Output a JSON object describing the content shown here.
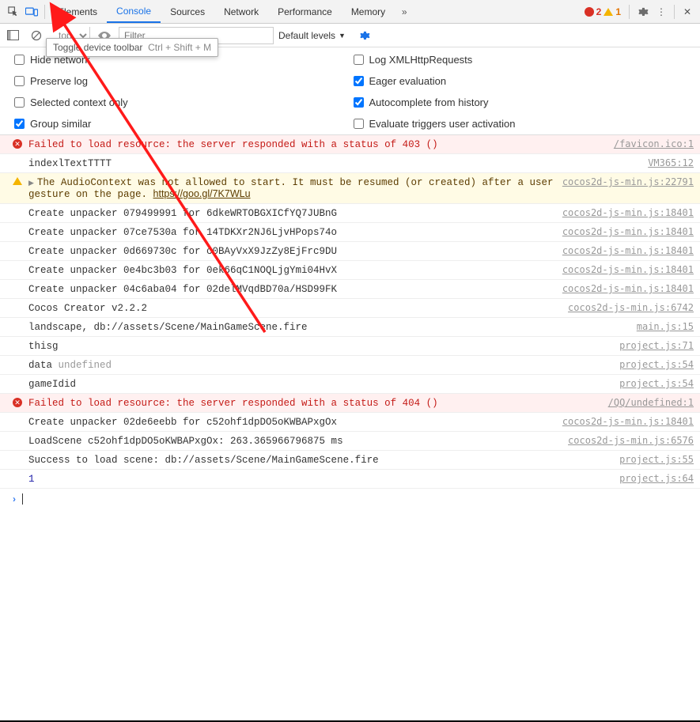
{
  "tabs": {
    "items": [
      "Elements",
      "Console",
      "Sources",
      "Network",
      "Performance",
      "Memory"
    ],
    "active_index": 1,
    "errors": "2",
    "warnings": "1"
  },
  "tooltip": {
    "text": "Toggle device toolbar",
    "shortcut": "Ctrl + Shift + M"
  },
  "toolbar": {
    "context": "top",
    "filter_placeholder": "Filter",
    "levels": "Default levels"
  },
  "settings": {
    "left": [
      {
        "label": "Hide network",
        "checked": false
      },
      {
        "label": "Preserve log",
        "checked": false
      },
      {
        "label": "Selected context only",
        "checked": false
      },
      {
        "label": "Group similar",
        "checked": true
      }
    ],
    "right": [
      {
        "label": "Log XMLHttpRequests",
        "checked": false
      },
      {
        "label": "Eager evaluation",
        "checked": true
      },
      {
        "label": "Autocomplete from history",
        "checked": true
      },
      {
        "label": "Evaluate triggers user activation",
        "checked": false
      }
    ]
  },
  "msgs": [
    {
      "type": "error",
      "text": "Failed to load resource: the server responded with a status of 403 ()",
      "src": "/favicon.ico:1"
    },
    {
      "type": "log",
      "text": "indexlTextTTTT",
      "src": "VM365:12"
    },
    {
      "type": "warn",
      "expand": true,
      "text": "The AudioContext was not allowed to start. It must be resumed (or created) after a user gesture on the page. ",
      "link": "https://goo.gl/7K7WLu",
      "src": "cocos2d-js-min.js:22791"
    },
    {
      "type": "log",
      "text": "Create unpacker 079499991 for 6dkeWRTOBGXICfYQ7JUBnG",
      "src": "cocos2d-js-min.js:18401"
    },
    {
      "type": "log",
      "text": "Create unpacker 07ce7530a for 14TDKXr2NJ6LjvHPops74o",
      "src": "cocos2d-js-min.js:18401"
    },
    {
      "type": "log",
      "text": "Create unpacker 0d669730c for c0BAyVxX9JzZy8EjFrc9DU",
      "src": "cocos2d-js-min.js:18401"
    },
    {
      "type": "log",
      "text": "Create unpacker 0e4bc3b03 for 0ek66qC1NOQLjgYmi04HvX",
      "src": "cocos2d-js-min.js:18401"
    },
    {
      "type": "log",
      "text": "Create unpacker 04c6aba04 for 02delMVqdBD70a/HSD99FK",
      "src": "cocos2d-js-min.js:18401"
    },
    {
      "type": "log",
      "text": "Cocos Creator v2.2.2",
      "src": "cocos2d-js-min.js:6742"
    },
    {
      "type": "log",
      "text": "landscape, db://assets/Scene/MainGameScene.fire",
      "src": "main.js:15"
    },
    {
      "type": "log",
      "text": "thisg",
      "src": "project.js:71"
    },
    {
      "type": "log",
      "html": "data <span class='grey'>undefined</span>",
      "src": "project.js:54"
    },
    {
      "type": "log",
      "text": "gameIdid",
      "src": "project.js:54"
    },
    {
      "type": "error",
      "text": "Failed to load resource: the server responded with a status of 404 ()",
      "src": "/QQ/undefined:1"
    },
    {
      "type": "log",
      "text": "Create unpacker 02de6eebb for c52ohf1dpDO5oKWBAPxgOx",
      "src": "cocos2d-js-min.js:18401"
    },
    {
      "type": "log",
      "text": "LoadScene c52ohf1dpDO5oKWBAPxgOx: 263.365966796875 ms",
      "src": "cocos2d-js-min.js:6576"
    },
    {
      "type": "log",
      "text": "Success to load scene: db://assets/Scene/MainGameScene.fire",
      "src": "project.js:55"
    },
    {
      "type": "log",
      "html": "<span class='num'>1</span>",
      "src": "project.js:64"
    }
  ]
}
